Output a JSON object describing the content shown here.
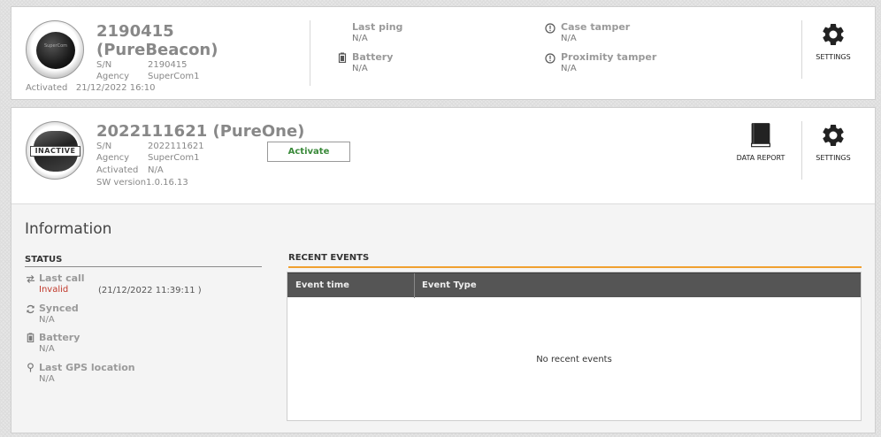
{
  "devices": [
    {
      "id_line": "2190415",
      "type_line": "(PureBeacon)",
      "avatar_text": "SuperCom",
      "sn_label": "S/N",
      "sn_value": "2190415",
      "agency_label": "Agency",
      "agency_value": "SuperCom1",
      "activated_label": "Activated",
      "activated_value": "21/12/2022 16:10",
      "last_ping_label": "Last ping",
      "last_ping_value": "N/A",
      "battery_label": "Battery",
      "battery_value": "N/A",
      "case_tamper_label": "Case tamper",
      "case_tamper_value": "N/A",
      "proximity_tamper_label": "Proximity tamper",
      "proximity_tamper_value": "N/A",
      "settings_label": "SETTINGS"
    },
    {
      "title": "2022111621 (PureOne)",
      "status_tag": "INACTIVE",
      "sn_label": "S/N",
      "sn_value": "2022111621",
      "agency_label": "Agency",
      "agency_value": "SuperCom1",
      "activated_label": "Activated",
      "activated_value": "N/A",
      "sw_label": "SW version",
      "sw_value": "1.0.16.13",
      "activate_button": "Activate",
      "data_report_label": "DATA REPORT",
      "settings_label": "SETTINGS"
    }
  ],
  "information": {
    "title": "Information",
    "status_heading": "STATUS",
    "last_call_label": "Last call",
    "last_call_value": "Invalid",
    "last_call_time": "(21/12/2022 11:39:11 )",
    "synced_label": "Synced",
    "synced_value": "N/A",
    "battery_label": "Battery",
    "battery_value": "N/A",
    "gps_label": "Last GPS location",
    "gps_value": "N/A"
  },
  "recent_events": {
    "heading": "RECENT EVENTS",
    "columns": [
      "Event time",
      "Event Type"
    ],
    "empty_message": "No recent events"
  },
  "colors": {
    "accent_orange": "#f0a030",
    "invalid_red": "#c0392b",
    "activate_green": "#3a8a3a",
    "table_header": "#555555"
  }
}
